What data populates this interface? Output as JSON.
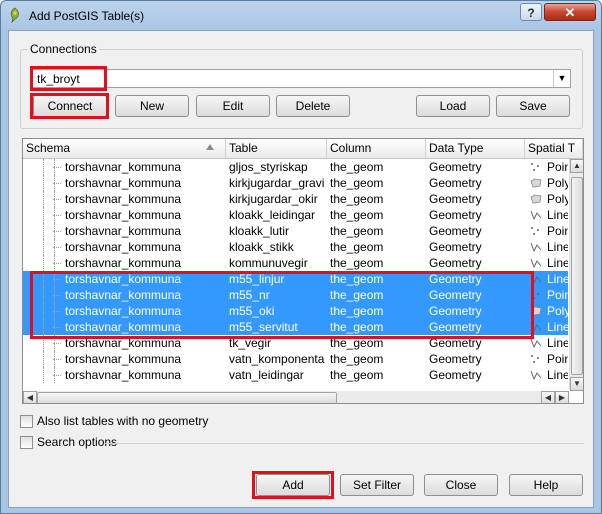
{
  "window": {
    "title": "Add PostGIS Table(s)",
    "help_label": "?",
    "close_label": "✕"
  },
  "connections": {
    "group_label": "Connections",
    "selected": "tk_broyt",
    "buttons": {
      "connect": "Connect",
      "new": "New",
      "edit": "Edit",
      "delete": "Delete",
      "load": "Load",
      "save": "Save"
    }
  },
  "table": {
    "columns": [
      "Schema",
      "Table",
      "Column",
      "Data Type",
      "Spatial T"
    ],
    "rows": [
      {
        "schema": "torshavnar_kommuna",
        "table": "gljos_styriskap",
        "column": "the_geom",
        "type": "Geometry",
        "spatial": "Poin",
        "icon": "point",
        "selected": false
      },
      {
        "schema": "torshavnar_kommuna",
        "table": "kirkjugardar_gravir",
        "column": "the_geom",
        "type": "Geometry",
        "spatial": "Poly",
        "icon": "polygon",
        "selected": false
      },
      {
        "schema": "torshavnar_kommuna",
        "table": "kirkjugardar_okir",
        "column": "the_geom",
        "type": "Geometry",
        "spatial": "Poly",
        "icon": "polygon",
        "selected": false
      },
      {
        "schema": "torshavnar_kommuna",
        "table": "kloakk_leidingar",
        "column": "the_geom",
        "type": "Geometry",
        "spatial": "Line",
        "icon": "line",
        "selected": false
      },
      {
        "schema": "torshavnar_kommuna",
        "table": "kloakk_lutir",
        "column": "the_geom",
        "type": "Geometry",
        "spatial": "Poin",
        "icon": "point",
        "selected": false
      },
      {
        "schema": "torshavnar_kommuna",
        "table": "kloakk_stikk",
        "column": "the_geom",
        "type": "Geometry",
        "spatial": "Line",
        "icon": "line",
        "selected": false
      },
      {
        "schema": "torshavnar_kommuna",
        "table": "kommunuvegir",
        "column": "the_geom",
        "type": "Geometry",
        "spatial": "Line",
        "icon": "line",
        "selected": false
      },
      {
        "schema": "torshavnar_kommuna",
        "table": "m55_linjur",
        "column": "the_geom",
        "type": "Geometry",
        "spatial": "Line",
        "icon": "line",
        "selected": true
      },
      {
        "schema": "torshavnar_kommuna",
        "table": "m55_nr",
        "column": "the_geom",
        "type": "Geometry",
        "spatial": "Poin",
        "icon": "point",
        "selected": true
      },
      {
        "schema": "torshavnar_kommuna",
        "table": "m55_oki",
        "column": "the_geom",
        "type": "Geometry",
        "spatial": "Poly",
        "icon": "polygon",
        "selected": true
      },
      {
        "schema": "torshavnar_kommuna",
        "table": "m55_servitut",
        "column": "the_geom",
        "type": "Geometry",
        "spatial": "Line",
        "icon": "line",
        "selected": true
      },
      {
        "schema": "torshavnar_kommuna",
        "table": "tk_vegir",
        "column": "the_geom",
        "type": "Geometry",
        "spatial": "Line",
        "icon": "line",
        "selected": false
      },
      {
        "schema": "torshavnar_kommuna",
        "table": "vatn_komponentar",
        "column": "the_geom",
        "type": "Geometry",
        "spatial": "Poin",
        "icon": "point",
        "selected": false
      },
      {
        "schema": "torshavnar_kommuna",
        "table": "vatn_leidingar",
        "column": "the_geom",
        "type": "Geometry",
        "spatial": "Line",
        "icon": "line",
        "selected": false
      }
    ]
  },
  "options": {
    "list_no_geometry": "Also list tables with no geometry",
    "search_options": "Search options"
  },
  "footer": {
    "add": "Add",
    "set_filter": "Set Filter",
    "close": "Close",
    "help": "Help"
  },
  "colors": {
    "selection": "#3399ff",
    "highlight": "#e2101d"
  }
}
